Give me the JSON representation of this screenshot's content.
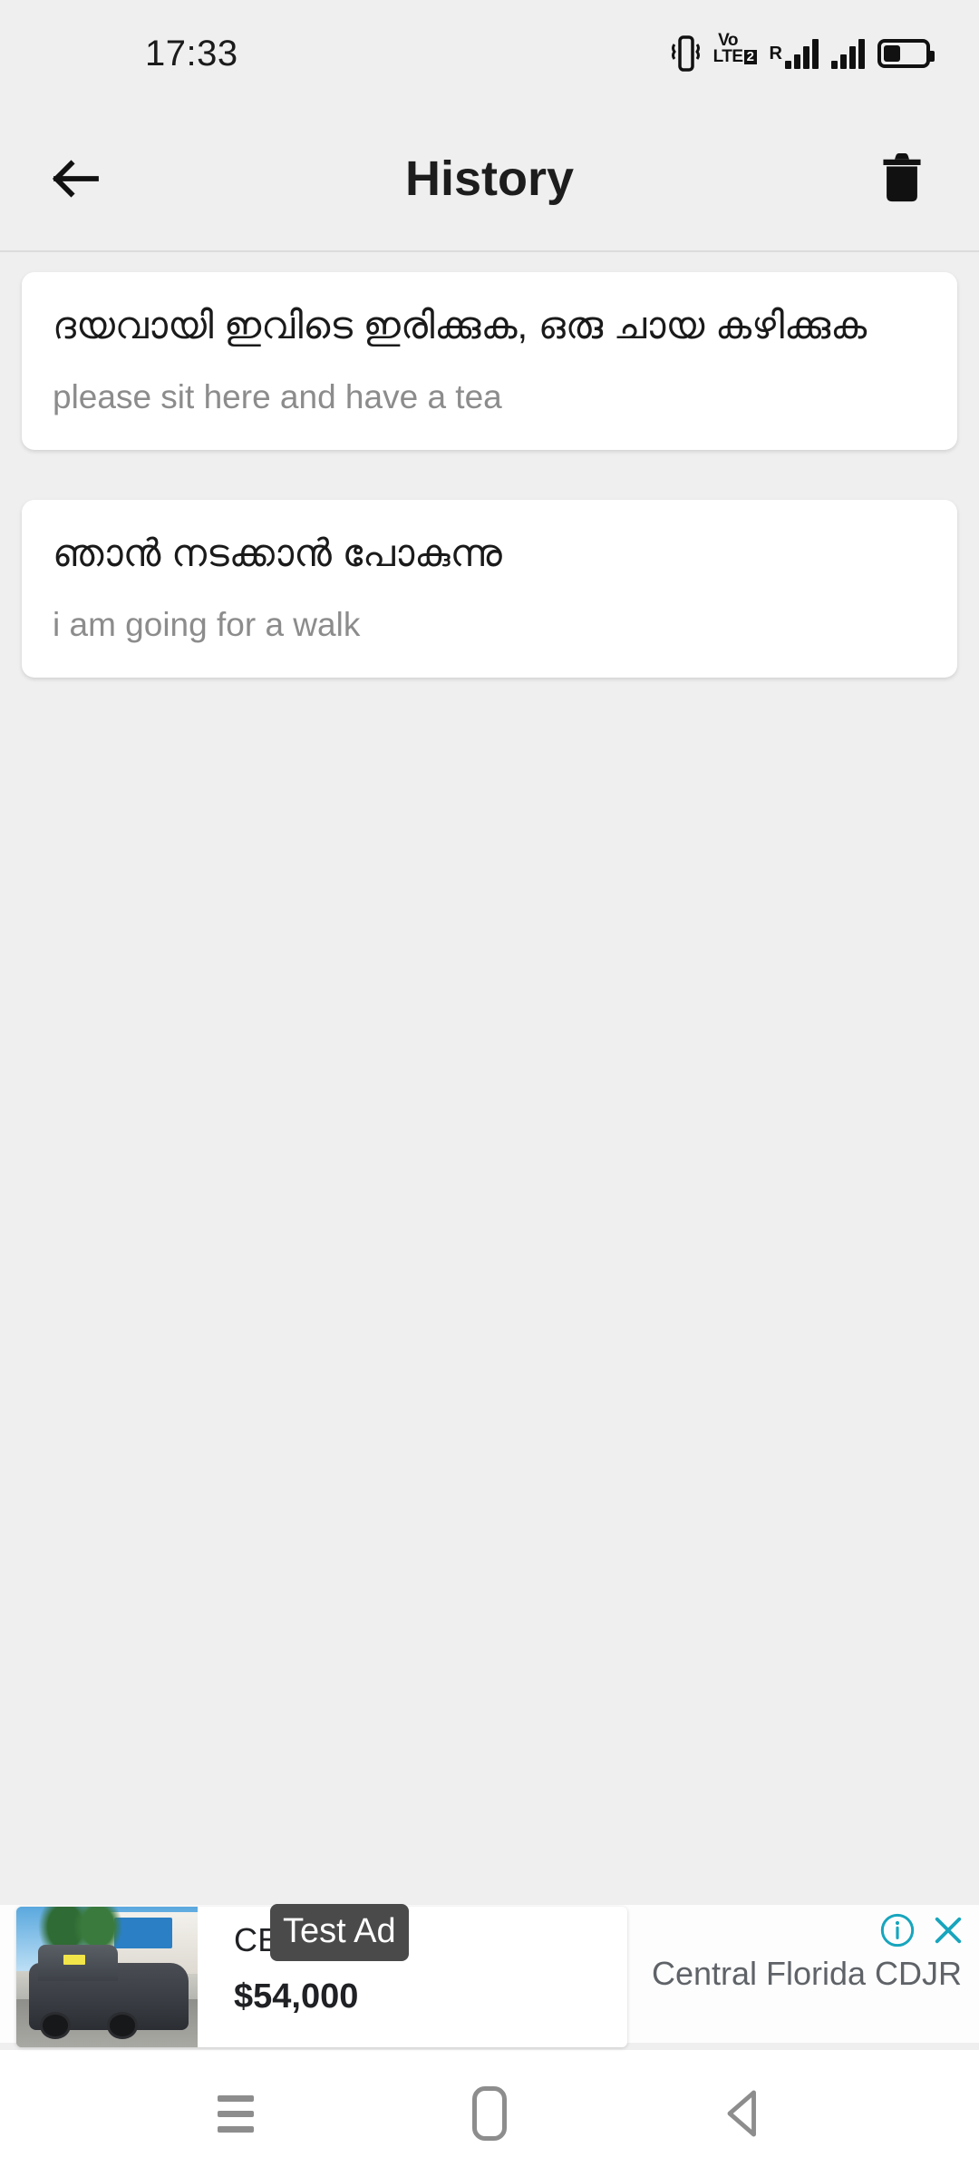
{
  "status_bar": {
    "time": "17:33",
    "icons": {
      "vibrate": "vibrate-icon",
      "volte_top": "VoLTE",
      "volte_label_line1": "Vo",
      "volte_label_line2": "LTE",
      "sim_index": "2",
      "roaming_label": "R",
      "battery_level_percent": 42
    }
  },
  "app_bar": {
    "back_label": "back-arrow",
    "title": "History",
    "delete_label": "delete-all"
  },
  "history": {
    "items": [
      {
        "source_text": "ദയവായി ഇവിടെ ഇരിക്കുക, ഒരു ചായ കഴിക്കുക",
        "translated_text": "please sit here and have a tea"
      },
      {
        "source_text": "ഞാൻ നടക്കാൻ പോകുന്നു",
        "translated_text": "i am going for a walk"
      }
    ]
  },
  "ad": {
    "headline": "CERTIFIED",
    "badge_label": "Test Ad",
    "price": "$54,000",
    "advertiser": "Central Florida CDJR",
    "info_icon": "info-circle-icon",
    "close_icon": "close-icon",
    "accent_color": "#18a5bd",
    "badge_bg_color": "#4a4a4a"
  },
  "nav_bar": {
    "recents_label": "recents",
    "home_label": "home",
    "back_label": "back"
  },
  "theme": {
    "page_bg": "#efefef",
    "card_bg": "#ffffff",
    "title_color": "#1d1d1d",
    "subtitle_color": "#8c8c8c"
  }
}
